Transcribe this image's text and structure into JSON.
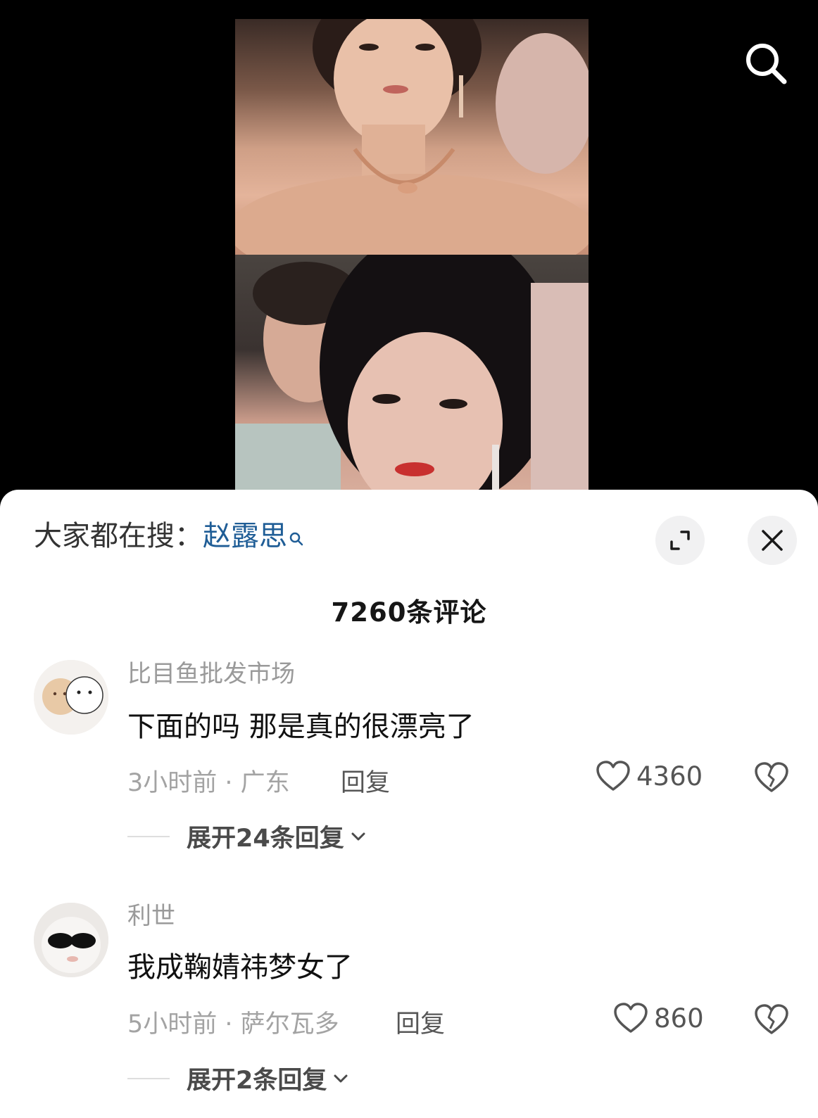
{
  "trend": {
    "prefix": "大家都在搜：",
    "keyword": "赵露思"
  },
  "comment_count_label": "7260条评论",
  "comments": [
    {
      "username": "比目鱼批发市场",
      "text": "下面的吗 那是真的很漂亮了",
      "meta": "3小时前 · 广东",
      "reply_label": "回复",
      "likes": "4360",
      "expand_label": "展开24条回复"
    },
    {
      "username": "利世",
      "text": "我成鞠婧祎梦女了",
      "meta": "5小时前 · 萨尔瓦多",
      "reply_label": "回复",
      "likes": "860",
      "expand_label": "展开2条回复"
    }
  ],
  "icons": {
    "search": "search-icon",
    "expand": "expand-icon",
    "close": "close-icon",
    "like": "heart-icon",
    "dislike": "broken-heart-icon",
    "chevron": "chevron-down-icon"
  },
  "colors": {
    "keyword": "#1f5d96",
    "sheet_bg": "#ffffff",
    "video_bg": "#000000"
  }
}
